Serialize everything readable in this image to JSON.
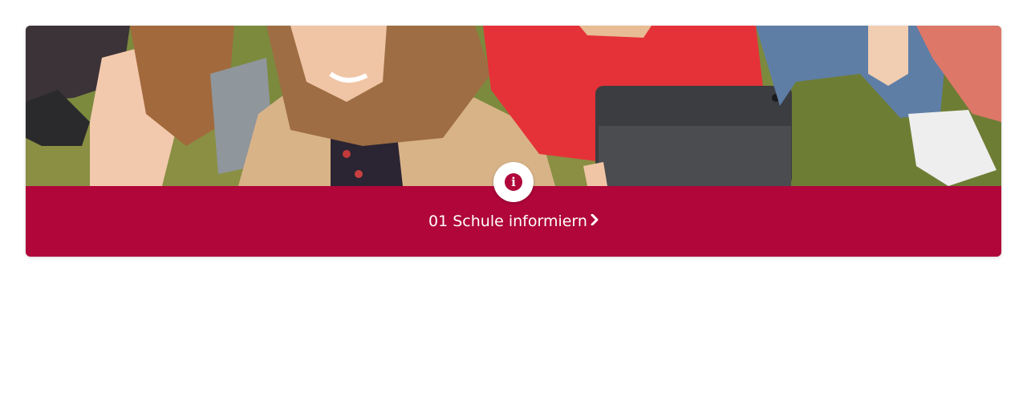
{
  "card": {
    "link_label": "01 Schule informiern",
    "info_icon": "info-icon",
    "chevron_icon": "chevron-right-icon",
    "photo_description_icon": "students-photo"
  },
  "colors": {
    "accent": "#b0063a",
    "background": "#ffffff",
    "text": "#ffffff"
  }
}
